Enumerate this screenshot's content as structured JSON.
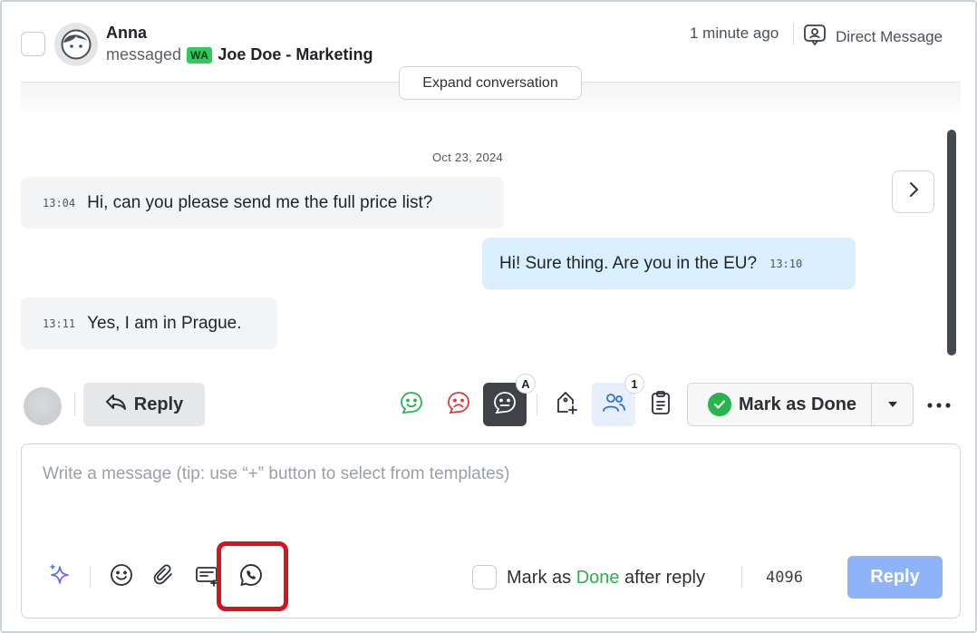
{
  "header": {
    "author": "Anna",
    "action": "messaged",
    "channel_badge": "WA",
    "channel_name": "Joe Doe - Marketing",
    "time_ago": "1 minute ago",
    "type_label": "Direct Message"
  },
  "conversation": {
    "expand_label": "Expand conversation",
    "date": "Oct 23, 2024",
    "messages": [
      {
        "direction": "in",
        "time": "13:04",
        "text": "Hi, can you please send me the full price list?"
      },
      {
        "direction": "out",
        "time": "13:10",
        "text": "Hi! Sure thing. Are you in the EU?"
      },
      {
        "direction": "in",
        "time": "13:11",
        "text": "Yes, I am in Prague."
      }
    ]
  },
  "toolbar": {
    "reply_label": "Reply",
    "auto_sentiment_badge": "A",
    "assignee_count": "1",
    "mark_done_label": "Mark as Done"
  },
  "composer": {
    "placeholder": "Write a message (tip: use “+” button to select from templates)",
    "after_reply_prefix": "Mark as ",
    "after_reply_done": "Done",
    "after_reply_suffix": " after reply",
    "char_count": "4096",
    "send_label": "Reply"
  },
  "colors": {
    "accent_green": "#27b34d",
    "whatsapp_badge": "#2ecb5a",
    "outgoing_bubble": "#daeffd",
    "send_button": "#8fb3f8",
    "highlight_border": "#d1161f",
    "negative_red": "#d93a3a"
  },
  "icons": [
    "user-avatar-icon",
    "direct-message-icon",
    "chevron-right-icon",
    "reply-arrow-icon",
    "positive-sentiment-icon",
    "negative-sentiment-icon",
    "neutral-sentiment-icon",
    "add-label-icon",
    "assignees-icon",
    "clipboard-icon",
    "checkmark-icon",
    "chevron-down-icon",
    "more-icon",
    "ai-sparkle-icon",
    "emoji-icon",
    "attachment-icon",
    "template-icon",
    "whatsapp-icon"
  ]
}
